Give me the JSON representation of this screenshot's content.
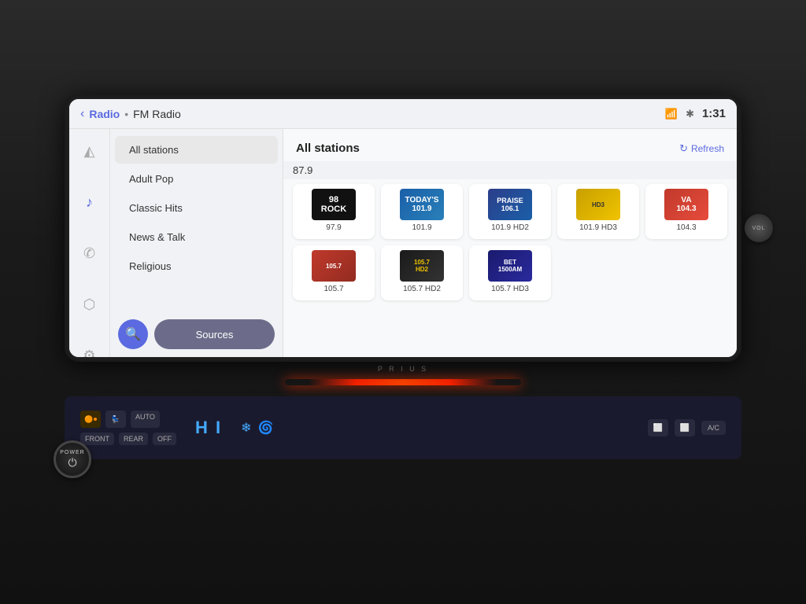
{
  "topBar": {
    "backLabel": "‹",
    "breadcrumb": {
      "radio": "Radio",
      "dot": "•",
      "sub": "FM Radio"
    },
    "statusIcons": [
      "no-signal",
      "bluetooth"
    ],
    "time": "1:31"
  },
  "sidebar": {
    "icons": [
      {
        "name": "navigation-icon",
        "symbol": "◭",
        "active": false
      },
      {
        "name": "music-icon",
        "symbol": "♪",
        "active": true
      },
      {
        "name": "phone-icon",
        "symbol": "✆",
        "active": false
      },
      {
        "name": "car-icon",
        "symbol": "⬡",
        "active": false
      },
      {
        "name": "settings-icon",
        "symbol": "⚙",
        "active": false
      }
    ]
  },
  "leftPanel": {
    "categories": [
      {
        "label": "All stations",
        "active": true
      },
      {
        "label": "Adult Pop",
        "active": false
      },
      {
        "label": "Classic Hits",
        "active": false
      },
      {
        "label": "News & Talk",
        "active": false
      },
      {
        "label": "Religious",
        "active": false
      }
    ],
    "searchLabel": "🔍",
    "sourcesLabel": "Sources"
  },
  "rightPanel": {
    "title": "All stations",
    "refreshLabel": "Refresh",
    "refreshIcon": "↻",
    "nowPlayingFreq": "87.9",
    "stations": [
      {
        "id": "98rock",
        "freq": "97.9",
        "logoText": "98\nROCK",
        "logoClass": "logo-98rock"
      },
      {
        "id": "1019",
        "freq": "101.9",
        "logoText": "TODAY'S\n101.9",
        "logoClass": "logo-1019"
      },
      {
        "id": "praise",
        "freq": "101.9 HD2",
        "logoText": "PRAISE\n106.1",
        "logoClass": "logo-praise"
      },
      {
        "id": "hd3gold",
        "freq": "101.9 HD3",
        "logoText": "HD3",
        "logoClass": "logo-hd3-gold"
      },
      {
        "id": "va1043",
        "freq": "104.3",
        "logoText": "VA\n104.3",
        "logoClass": "logo-va"
      },
      {
        "id": "1057",
        "freq": "105.7",
        "logoText": "105.7",
        "logoClass": "logo-105"
      },
      {
        "id": "1057hd2",
        "freq": "105.7 HD2",
        "logoText": "105.7\nHD2",
        "logoClass": "logo-105hd2"
      },
      {
        "id": "bet",
        "freq": "105.7 HD3",
        "logoText": "BET\n1500AM",
        "logoClass": "logo-bet"
      }
    ]
  },
  "climate": {
    "tempDisplay": "H I",
    "autoLabel": "AUTO",
    "offLabel": "OFF",
    "frontLabel": "FRONT",
    "rearLabel": "REAR",
    "acLabel": "A/C"
  },
  "powerBtn": {
    "label": "POWER"
  }
}
